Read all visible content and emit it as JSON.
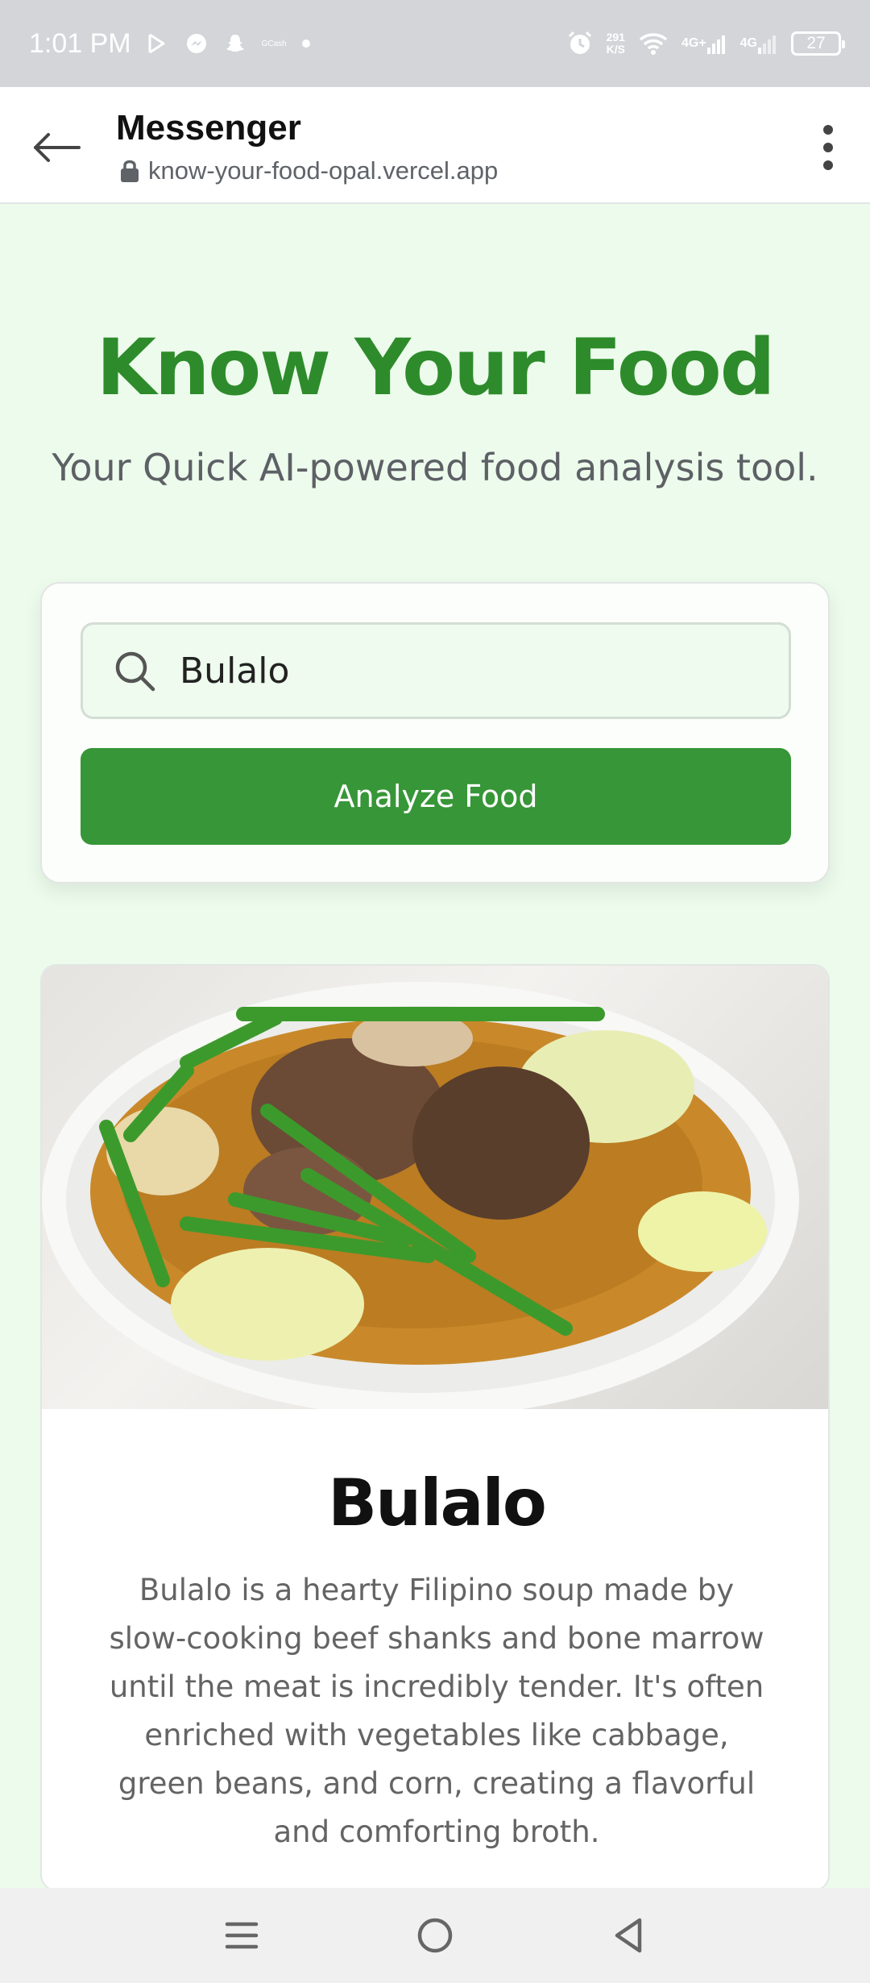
{
  "status_bar": {
    "time": "1:01 PM",
    "net_speed_value": "291",
    "net_speed_unit": "K/S",
    "signal_1_label": "4G+",
    "signal_2_label": "4G",
    "battery": "27",
    "icons": [
      "play-store-icon",
      "messenger-icon",
      "snapchat-icon",
      "gcash-icon",
      "dot-icon",
      "alarm-icon",
      "wifi-icon",
      "signal-icon",
      "battery-icon"
    ],
    "gcash_label": "GCash"
  },
  "browser_header": {
    "title": "Messenger",
    "url": "know-your-food-opal.vercel.app"
  },
  "hero": {
    "title": "Know Your Food",
    "subtitle": "Your Quick AI-powered food analysis tool."
  },
  "search": {
    "value": "Bulalo",
    "button_label": "Analyze Food"
  },
  "result": {
    "name": "Bulalo",
    "description": "Bulalo is a hearty Filipino soup made by slow-cooking beef shanks and bone marrow until the meat is incredibly tender. It's often enriched with vegetables like cabbage, green beans, and corn, creating a flavorful and comforting broth."
  },
  "colors": {
    "brand_green": "#2e8b2b",
    "button_green": "#379637",
    "page_bg": "#ecfbec"
  }
}
